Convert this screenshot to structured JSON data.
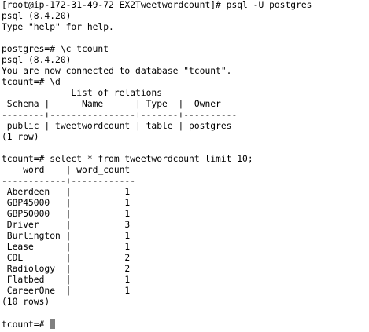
{
  "terminal": {
    "cursor_color": "#808080",
    "lines": [
      "[root@ip-172-31-49-72 EX2Tweetwordcount]# psql -U postgres",
      "psql (8.4.20)",
      "Type \"help\" for help.",
      "",
      "postgres=# \\c tcount",
      "psql (8.4.20)",
      "You are now connected to database \"tcount\".",
      "tcount=# \\d",
      "             List of relations",
      " Schema |      Name      | Type  |  Owner",
      "--------+----------------+-------+----------",
      " public | tweetwordcount | table | postgres",
      "(1 row)",
      "",
      "tcount=# select * from tweetwordcount limit 10;",
      "    word    | word_count",
      "------------+------------",
      " Aberdeen   |          1",
      " GBP45000   |          1",
      " GBP50000   |          1",
      " Driver     |          3",
      " Burlington |          1",
      " Lease      |          1",
      " CDL        |          2",
      " Radiology  |          2",
      " Flatbed    |          1",
      " CareerOne  |          1",
      "(10 rows)",
      ""
    ],
    "prompt": "tcount=# "
  }
}
